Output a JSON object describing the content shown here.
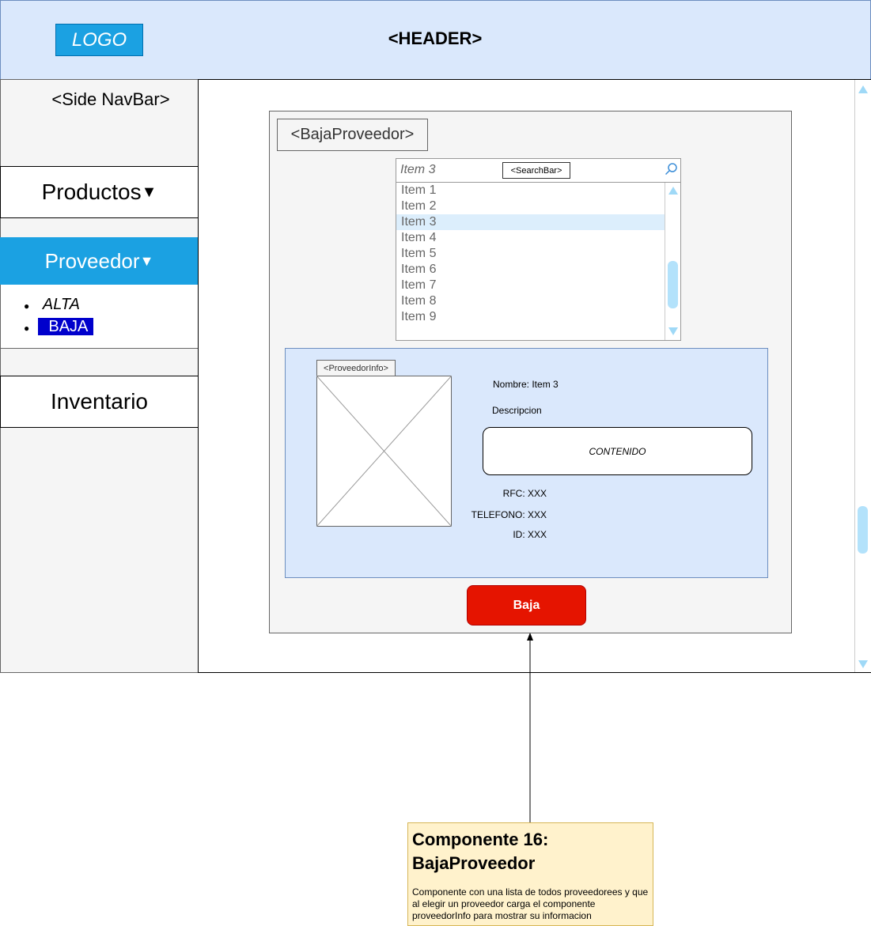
{
  "header": {
    "logo": "LOGO",
    "title": "<HEADER>"
  },
  "sidebar": {
    "title": "<Side NavBar>",
    "items": [
      {
        "label": "Productos",
        "arrow": "▼"
      },
      {
        "label": "Proveedor",
        "arrow": "▼"
      },
      {
        "label": "Inventario"
      }
    ],
    "submenu": [
      "ALTA",
      "BAJA"
    ]
  },
  "component": {
    "label": "<BajaProveedor>",
    "search": {
      "value": "Item 3",
      "label": "<SearchBar>"
    },
    "list_items": [
      "Item 1",
      "Item 2",
      "Item 3",
      "Item 4",
      "Item 5",
      "Item 6",
      "Item 7",
      "Item 8",
      "Item 9"
    ],
    "selected_item": "Item 3",
    "info": {
      "label": "<ProveedorInfo>",
      "nombre": "Nombre: Item 3",
      "descripcion": "Descripcion",
      "contenido": "CONTENIDO",
      "rfc": "RFC: XXX",
      "telefono": "TELEFONO: XXX",
      "id": "ID: XXX"
    },
    "button": "Baja"
  },
  "note": {
    "title": "Componente 16: BajaProveedor",
    "body": "Componente con una lista de todos proveedorees y que al elegir un proveedor carga el componente proveedorInfo para mostrar su informacion"
  },
  "colors": {
    "header_bg": "#dae8fc",
    "logo_bg": "#1ba1e2",
    "nav_active_bg": "#1ba1e2",
    "button_bg": "#e51400",
    "note_bg": "#fff2cc",
    "info_bg": "#dae8fc"
  }
}
